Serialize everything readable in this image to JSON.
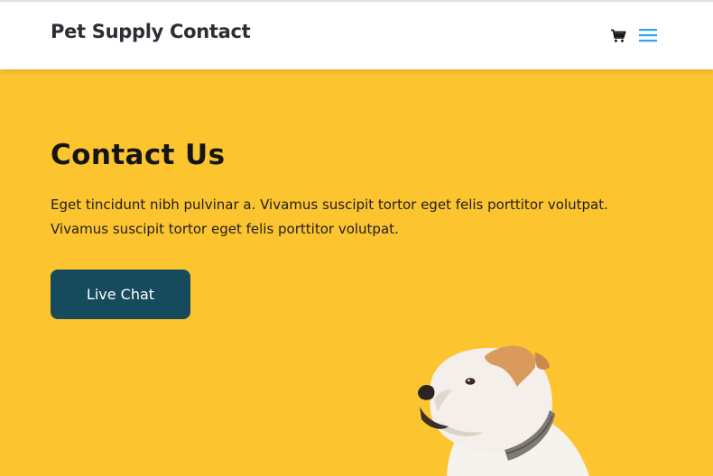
{
  "header": {
    "brand": "Pet Supply Contact",
    "cart_icon": "shopping-cart-icon",
    "menu_icon": "hamburger-menu-icon",
    "accent_color": "#2ea3f2"
  },
  "hero": {
    "background_color": "#fcc42f",
    "title": "Contact Us",
    "description": "Eget tincidunt nibh pulvinar a. Vivamus suscipit tortor eget felis porttitor volutpat. Vivamus suscipit tortor eget felis porttitor volutpat.",
    "cta_label": "Live Chat",
    "cta_color": "#164a5d",
    "image": "bulldog-photo"
  }
}
